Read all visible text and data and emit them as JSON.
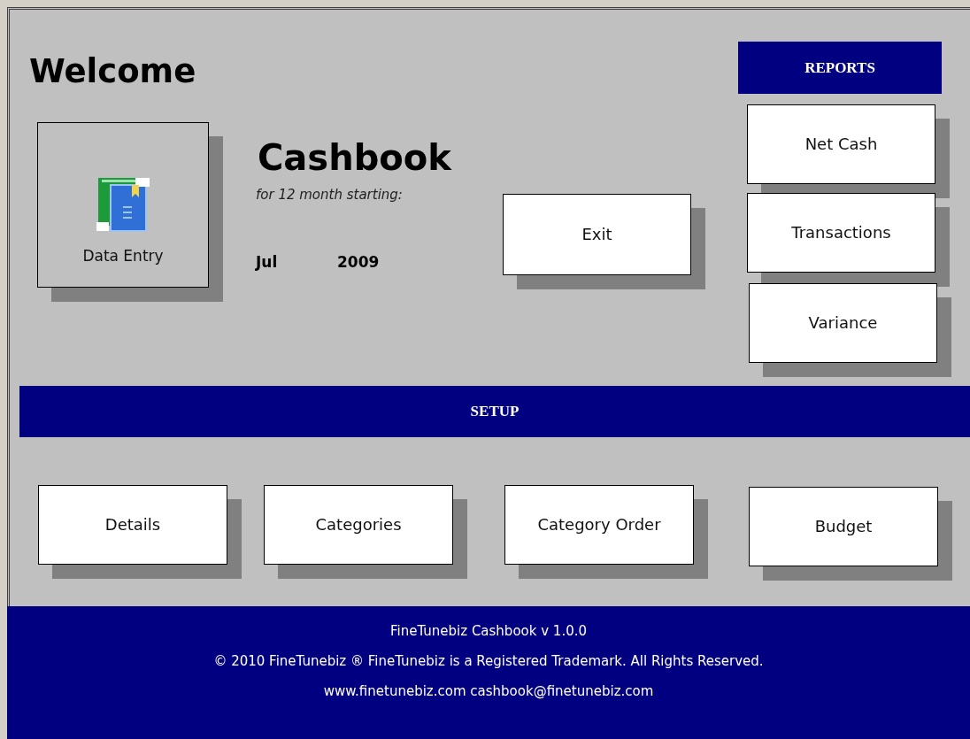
{
  "heading": "Welcome",
  "data_entry_button": {
    "label": "Data Entry"
  },
  "app": {
    "title": "Cashbook",
    "subtitle": "for 12 month starting:",
    "start_month": "Jul",
    "start_year": "2009"
  },
  "exit_button": {
    "label": "Exit"
  },
  "reports": {
    "title": "REPORTS",
    "buttons": [
      "Net Cash",
      "Transactions",
      "Variance"
    ]
  },
  "setup": {
    "title": "SETUP",
    "buttons": [
      "Details",
      "Categories",
      "Category Order",
      "Budget"
    ]
  },
  "footer": {
    "lines": [
      "FineTunebiz Cashbook v 1.0.0",
      "© 2010 FineTunebiz ® FineTunebiz is a Registered Trademark. All Rights Reserved.",
      "www.finetunebiz.com cashbook@finetunebiz.com"
    ]
  }
}
